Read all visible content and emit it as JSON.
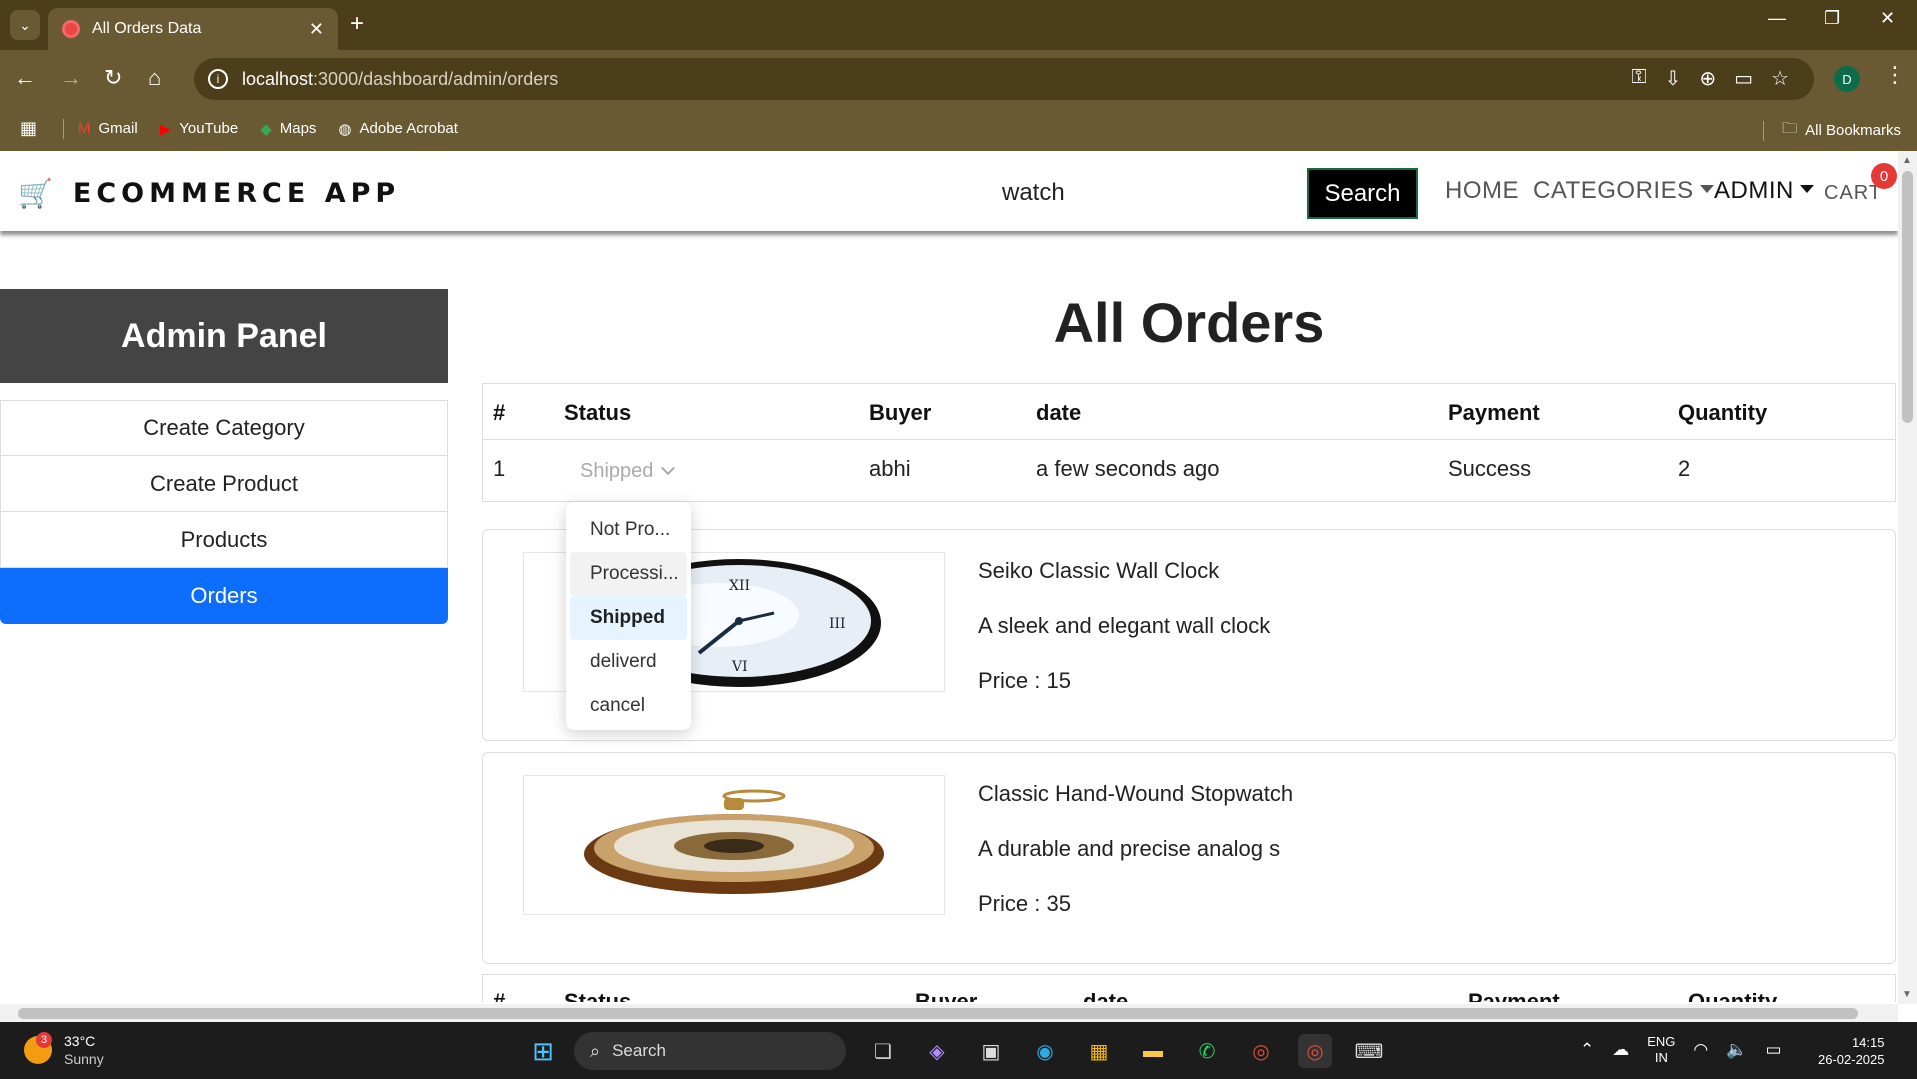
{
  "browser": {
    "tab_title": "All Orders Data",
    "url_host": "localhost",
    "url_path": ":3000/dashboard/admin/orders",
    "profile_initial": "D",
    "bookmarks": [
      {
        "label": "Gmail",
        "icon": "gmail-icon"
      },
      {
        "label": "YouTube",
        "icon": "youtube-icon"
      },
      {
        "label": "Maps",
        "icon": "maps-icon"
      },
      {
        "label": "Adobe Acrobat",
        "icon": "acrobat-icon"
      }
    ],
    "all_bookmarks": "All Bookmarks"
  },
  "header": {
    "brand": "ECOMMERCE APP",
    "search_value": "watch",
    "search_button": "Search",
    "nav": {
      "home": "HOME",
      "categories": "CATEGORIES",
      "admin": "ADMIN",
      "cart": "CART",
      "cart_count": "0"
    }
  },
  "sidebar": {
    "title": "Admin Panel",
    "items": [
      {
        "label": "Create Category",
        "active": false
      },
      {
        "label": "Create Product",
        "active": false
      },
      {
        "label": "Products",
        "active": false
      },
      {
        "label": "Orders",
        "active": true
      }
    ]
  },
  "main": {
    "title": "All Orders",
    "table": {
      "headers": [
        "#",
        "Status",
        "Buyer",
        "date",
        "Payment",
        "Quantity"
      ],
      "row": {
        "index": "1",
        "status": "Shipped",
        "buyer": "abhi",
        "date": "a few seconds ago",
        "payment": "Success",
        "quantity": "2"
      }
    },
    "products": [
      {
        "name": "Seiko Classic Wall Clock",
        "description": "A sleek and elegant wall clock",
        "price": "Price : 15"
      },
      {
        "name": "Classic Hand-Wound Stopwatch",
        "description": "A durable and precise analog s",
        "price": "Price : 35"
      }
    ],
    "status_options": [
      "Not Pro...",
      "Processi...",
      "Shipped",
      "deliverd",
      "cancel"
    ],
    "status_selected": "Shipped",
    "next_table_headers": [
      "#",
      "Status",
      "Buyer",
      "date",
      "Payment",
      "Quantity"
    ]
  },
  "taskbar": {
    "temp": "33°C",
    "condition": "Sunny",
    "weather_badge": "3",
    "search": "Search",
    "lang_1": "ENG",
    "lang_2": "IN",
    "time": "14:15",
    "date": "26-02-2025"
  },
  "colors": {
    "chrome_dark": "#4c3d1b",
    "chrome_mid": "#6a5a33",
    "accent": "#0d6efd",
    "sidebar_header": "#444444"
  }
}
